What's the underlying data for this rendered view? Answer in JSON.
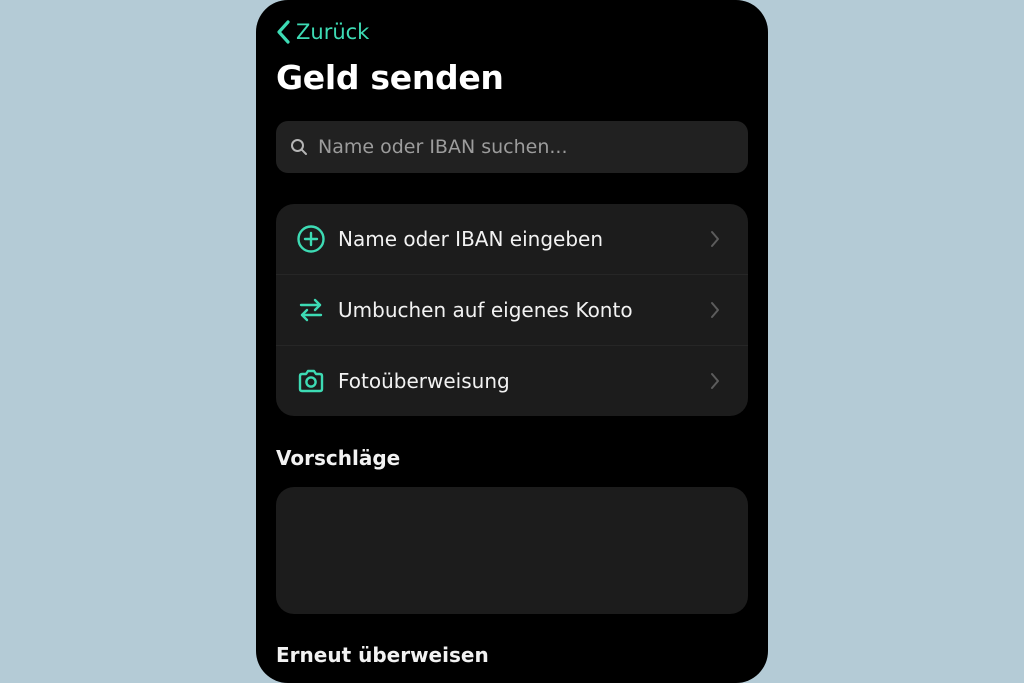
{
  "nav": {
    "back_label": "Zurück"
  },
  "page": {
    "title": "Geld senden"
  },
  "search": {
    "placeholder": "Name oder IBAN suchen..."
  },
  "menu": {
    "items": [
      {
        "icon": "plus-circle-icon",
        "label": "Name oder IBAN eingeben"
      },
      {
        "icon": "transfer-arrows-icon",
        "label": "Umbuchen auf eigenes Konto"
      },
      {
        "icon": "camera-icon",
        "label": "Fotoüberweisung"
      }
    ]
  },
  "sections": {
    "suggestions_title": "Vorschläge",
    "repeat_title": "Erneut überweisen"
  },
  "colors": {
    "accent": "#3ddbb4",
    "background": "#b4cbd6",
    "screen": "#000000",
    "card": "#1c1c1c"
  }
}
